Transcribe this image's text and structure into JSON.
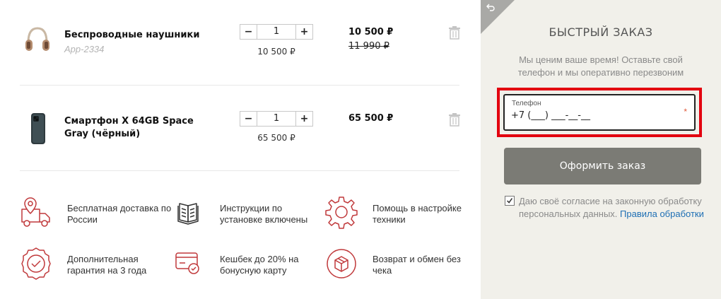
{
  "cart": {
    "items": [
      {
        "name": "Беспроводные наушники",
        "sku": "App-2334",
        "minus": "−",
        "plus": "+",
        "quantity": "1",
        "unit_price": "10 500 ₽",
        "total": "10 500 ₽",
        "old_total": "11 990 ₽"
      },
      {
        "name": "Смартфон X 64GB Space Gray (чёрный)",
        "minus": "−",
        "plus": "+",
        "quantity": "1",
        "unit_price": "65 500 ₽",
        "total": "65 500 ₽"
      }
    ]
  },
  "features": [
    {
      "icon": "delivery-truck-icon",
      "text": "Бесплатная доставка по России"
    },
    {
      "icon": "instruction-book-icon",
      "text": "Инструкции по установке включены"
    },
    {
      "icon": "gear-icon",
      "text": "Помощь в настройке техники"
    },
    {
      "icon": "warranty-badge-icon",
      "text": "Дополнительная гарантия на 3 года"
    },
    {
      "icon": "cashback-card-icon",
      "text": "Кешбек до 20% на бонусную карту"
    },
    {
      "icon": "return-box-icon",
      "text": "Возврат и обмен без чека"
    }
  ],
  "quick_order": {
    "title": "БЫСТРЫЙ ЗАКАЗ",
    "subtitle": "Мы ценим ваше время! Оставьте свой телефон и мы оперативно перезвоним",
    "phone_label": "Телефон",
    "phone_value": "+7 (___) ___-__-__",
    "required_mark": "*",
    "submit_label": "Оформить заказ",
    "consent_text": "Даю своё согласие на законную обработку персональных данных.",
    "consent_link": "Правила обработки",
    "consent_checked": true
  },
  "colors": {
    "accent_red": "#c0393b",
    "panel_bg": "#f1f0ea",
    "button_bg": "#7b7b75",
    "highlight": "#e3000f",
    "link": "#1e6fb4"
  }
}
